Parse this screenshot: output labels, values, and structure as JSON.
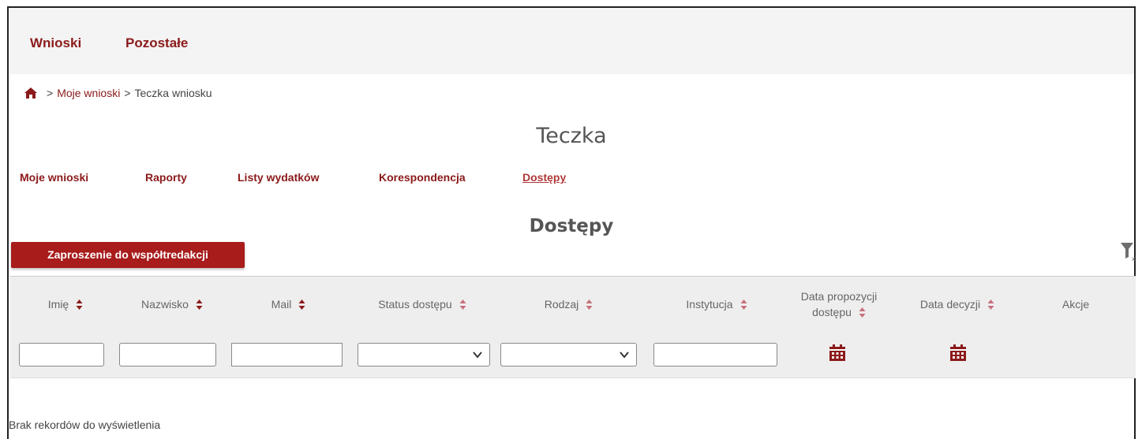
{
  "topnav": {
    "items": [
      {
        "label": "Wnioski"
      },
      {
        "label": "Pozostałe"
      }
    ]
  },
  "breadcrumb": {
    "items": [
      "Moje wnioski",
      "Teczka wniosku"
    ],
    "separator": ">"
  },
  "page": {
    "title": "Teczka",
    "section_title": "Dostępy"
  },
  "subtabs": [
    {
      "label": "Moje wnioski"
    },
    {
      "label": "Raporty"
    },
    {
      "label": "Listy wydatków"
    },
    {
      "label": "Korespondencja"
    },
    {
      "label": "Dostępy",
      "active": true
    }
  ],
  "actions": {
    "invite_label": "Zaproszenie do współtredakcji"
  },
  "table": {
    "columns": [
      {
        "label": "Imię"
      },
      {
        "label": "Nazwisko"
      },
      {
        "label": "Mail"
      },
      {
        "label": "Status dostępu"
      },
      {
        "label": "Rodzaj"
      },
      {
        "label": "Instytucja"
      },
      {
        "label_line1": "Data propozycji",
        "label_line2": "dostępu"
      },
      {
        "label": "Data decyzji"
      },
      {
        "label": "Akcje"
      }
    ],
    "filters": {
      "imie": "",
      "nazwisko": "",
      "mail": "",
      "status": "",
      "rodzaj": "",
      "instytucja": ""
    },
    "empty_message": "Brak rekordów do wyświetlenia"
  },
  "colors": {
    "brand": "#8b1a1a",
    "button": "#a81c1c",
    "sort_active": "#8b1a1a",
    "header_bg": "#eeeeee"
  },
  "icons": {
    "home": "home-icon",
    "sort": "sort-icon",
    "chevron": "chevron-down-icon",
    "calendar": "calendar-icon",
    "filter_clear": "filter-clear-icon"
  }
}
